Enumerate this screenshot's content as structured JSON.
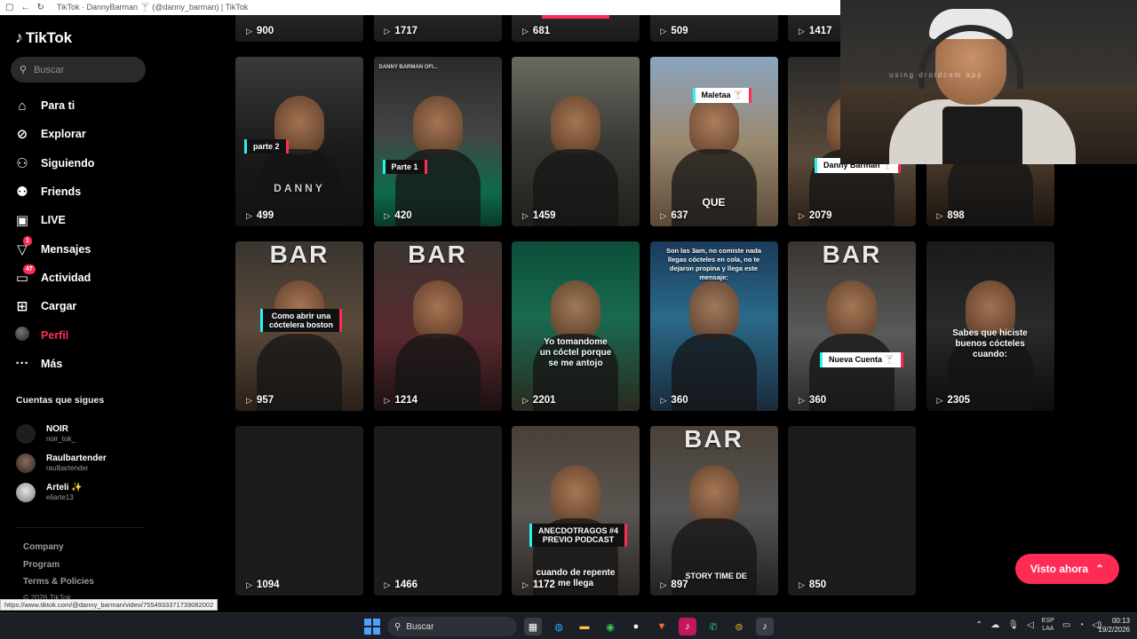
{
  "browser": {
    "tab_title": "TikTok · DannyBarman 🍸 (@danny_barman) | TikTok",
    "status_url": "https://www.tiktok.com/@danny_barman/video/7554933371739082002"
  },
  "sidebar": {
    "logo": "TikTok",
    "search_placeholder": "Buscar",
    "nav": [
      {
        "label": "Para ti",
        "icon": "home-icon",
        "glyph": "⌂"
      },
      {
        "label": "Explorar",
        "icon": "compass-icon",
        "glyph": "⊘"
      },
      {
        "label": "Siguiendo",
        "icon": "user-follow-icon",
        "glyph": "⚇"
      },
      {
        "label": "Friends",
        "icon": "friends-icon",
        "glyph": "⚉"
      },
      {
        "label": "LIVE",
        "icon": "live-icon",
        "glyph": "▣"
      },
      {
        "label": "Mensajes",
        "icon": "messages-icon",
        "glyph": "▽",
        "badge": "1"
      },
      {
        "label": "Actividad",
        "icon": "activity-icon",
        "glyph": "▭",
        "badge": "47"
      },
      {
        "label": "Cargar",
        "icon": "upload-icon",
        "glyph": "⊞"
      },
      {
        "label": "Perfil",
        "icon": "avatar",
        "glyph": ""
      },
      {
        "label": "Más",
        "icon": "more-icon",
        "glyph": "···"
      }
    ],
    "following_title": "Cuentas que sigues",
    "following": [
      {
        "name": "NOIR",
        "user": "noir_tok_"
      },
      {
        "name": "Raulbartender",
        "user": "raulbartender"
      },
      {
        "name": "Arteli ✨",
        "user": "eliarte13"
      }
    ],
    "footer": [
      "Company",
      "Program",
      "Terms & Policies"
    ],
    "copyright": "© 2026 TikTok"
  },
  "videos_top_row": [
    "900",
    "1717",
    "681",
    "509",
    "1417"
  ],
  "videos": [
    {
      "views": "499",
      "caption": "parte 2",
      "caption_style": "tag",
      "extra": "DANNY"
    },
    {
      "views": "420",
      "caption": "Parte 1",
      "caption_style": "tag",
      "extra": "DANNY BARMAN OFI..."
    },
    {
      "views": "1459",
      "caption": "",
      "caption_style": "none",
      "extra": ""
    },
    {
      "views": "637",
      "caption": "Maletaa 🍸",
      "caption_style": "tag-white",
      "extra": "QUE"
    },
    {
      "views": "2079",
      "caption": "Danny Barman 🍸",
      "caption_style": "tag-white",
      "extra": ""
    },
    {
      "views": "898",
      "caption": "",
      "caption_style": "none",
      "extra": ""
    },
    {
      "views": "957",
      "caption": "Como abrir una\ncóctelera boston",
      "caption_style": "tag",
      "extra": "BAR"
    },
    {
      "views": "1214",
      "caption": "",
      "caption_style": "none",
      "extra": "BAR"
    },
    {
      "views": "2201",
      "caption": "Yo tomandome\nun cóctel porque\nse me antojo",
      "caption_style": "plain",
      "extra": ""
    },
    {
      "views": "360",
      "caption": "Son las 3am, no comiste nada\nllegas cócteles en cola, no te\ndejaron propina y llega este\nmensaje:",
      "caption_style": "plain-top",
      "extra": ""
    },
    {
      "views": "360",
      "caption": "Nueva Cuenta 🍸",
      "caption_style": "tag-white",
      "extra": "BAR"
    },
    {
      "views": "2305",
      "caption": "Sabes que hiciste\nbuenos cócteles\ncuando:",
      "caption_style": "plain",
      "extra": ""
    },
    {
      "views": "1094",
      "caption": "",
      "caption_style": "empty",
      "extra": ""
    },
    {
      "views": "1466",
      "caption": "",
      "caption_style": "empty",
      "extra": ""
    },
    {
      "views": "1172",
      "caption": "ANECDOTRAGOS #4\nPREVIO PODCAST",
      "caption_style": "tag",
      "extra": "cuando de repente\nme llega"
    },
    {
      "views": "897",
      "caption": "STORY TIME DE",
      "caption_style": "bottom",
      "extra": "BAR"
    },
    {
      "views": "850",
      "caption": "",
      "caption_style": "empty",
      "extra": ""
    }
  ],
  "webcam": {
    "watermark": "using droidcam app"
  },
  "visto_button": "Visto ahora",
  "taskbar": {
    "search": "Buscar",
    "lang_top": "ESP",
    "lang_bottom": "LAA",
    "time": "00:13",
    "date": "19/2/2026"
  },
  "colors": {
    "accent": "#fe2c55",
    "cyan": "#25f4ee"
  }
}
